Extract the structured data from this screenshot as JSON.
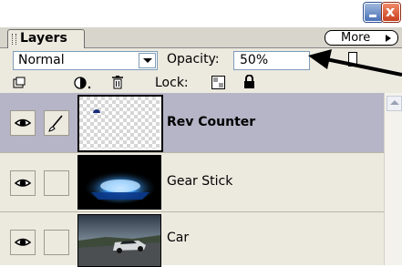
{
  "window": {
    "minimize_icon": "minimize-icon",
    "close_glyph": "x"
  },
  "tab": {
    "label": "Layers"
  },
  "more_button": {
    "label": "More"
  },
  "blend_mode": {
    "value": "Normal"
  },
  "opacity": {
    "label": "Opacity:",
    "value": "50%"
  },
  "lock": {
    "label": "Lock:"
  },
  "layers": [
    {
      "name": "Rev Counter",
      "selected": true,
      "visible": true,
      "thumbnail": "transparent-checker-with-dial"
    },
    {
      "name": "Gear Stick",
      "selected": false,
      "visible": true,
      "thumbnail": "blue-glowing-gear-knob"
    },
    {
      "name": "Car",
      "selected": false,
      "visible": true,
      "thumbnail": "car-on-road-photo"
    }
  ],
  "colors": {
    "selected_row": "#b6b4c7",
    "panel_bg": "#ece9df",
    "tab_bg": "#d8d5cc"
  }
}
